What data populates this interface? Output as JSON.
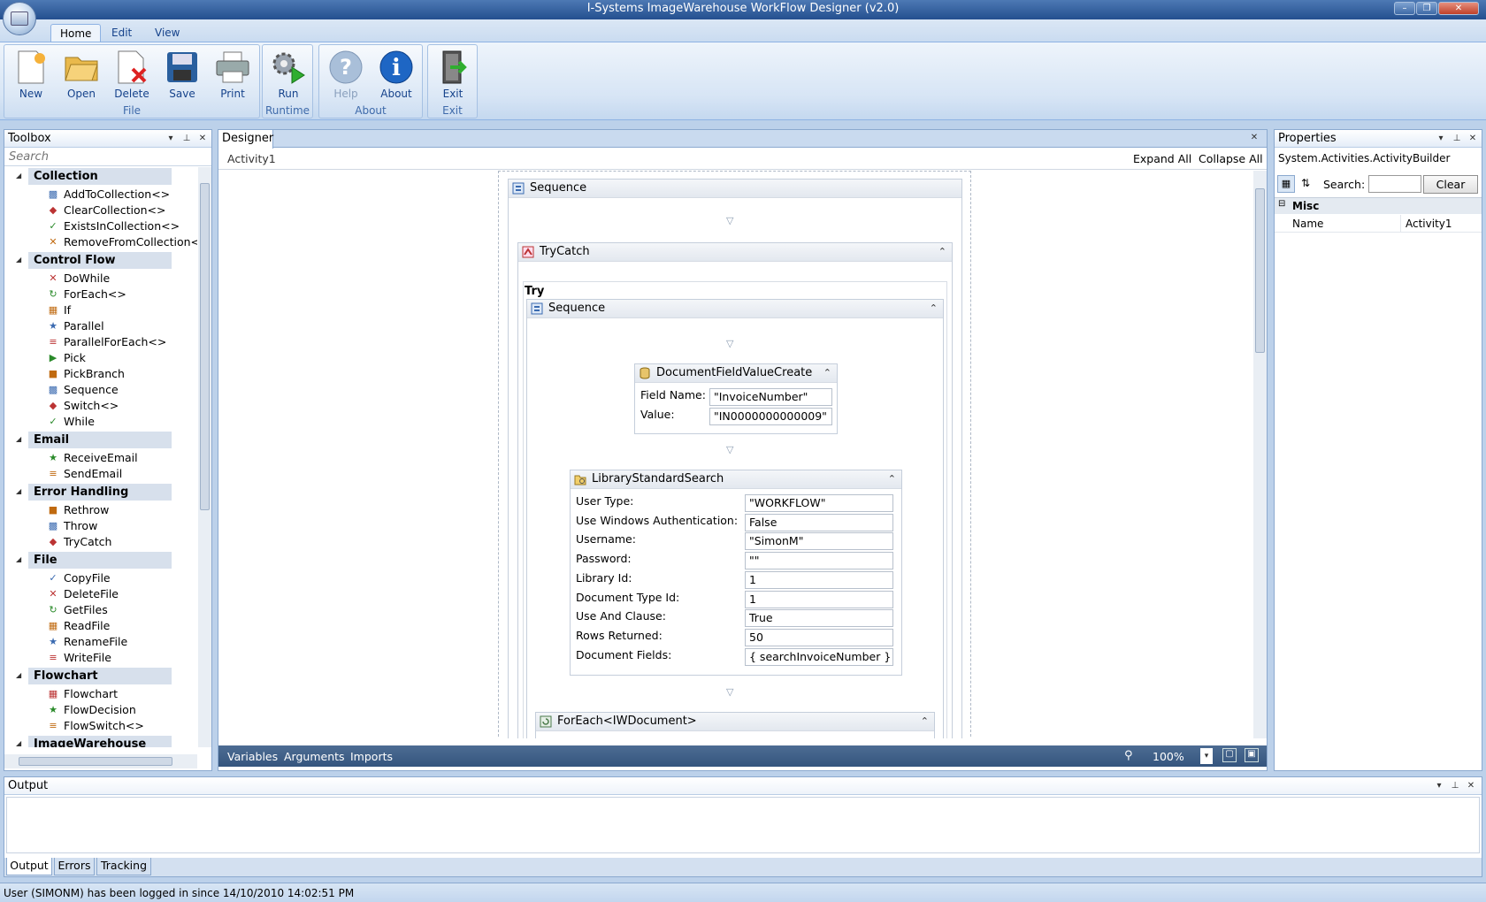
{
  "window": {
    "title": "I-Systems ImageWarehouse WorkFlow Designer (v2.0)"
  },
  "ribbon": {
    "tabs": [
      "Home",
      "Edit",
      "View"
    ],
    "buttons": {
      "new": "New",
      "open": "Open",
      "delete": "Delete",
      "save": "Save",
      "print": "Print",
      "run": "Run",
      "help": "Help",
      "about": "About",
      "exit": "Exit"
    },
    "groups": {
      "file": "File",
      "runtime": "Runtime",
      "about": "About",
      "exit": "Exit"
    }
  },
  "toolbox": {
    "title": "Toolbox",
    "search_placeholder": "Search",
    "categories": [
      {
        "name": "Collection",
        "items": [
          "AddToCollection<>",
          "ClearCollection<>",
          "ExistsInCollection<>",
          "RemoveFromCollection<>"
        ]
      },
      {
        "name": "Control Flow",
        "items": [
          "DoWhile",
          "ForEach<>",
          "If",
          "Parallel",
          "ParallelForEach<>",
          "Pick",
          "PickBranch",
          "Sequence",
          "Switch<>",
          "While"
        ]
      },
      {
        "name": "Email",
        "items": [
          "ReceiveEmail",
          "SendEmail"
        ]
      },
      {
        "name": "Error Handling",
        "items": [
          "Rethrow",
          "Throw",
          "TryCatch"
        ]
      },
      {
        "name": "File",
        "items": [
          "CopyFile",
          "DeleteFile",
          "GetFiles",
          "ReadFile",
          "RenameFile",
          "WriteFile"
        ]
      },
      {
        "name": "Flowchart",
        "items": [
          "Flowchart",
          "FlowDecision",
          "FlowSwitch<>"
        ]
      },
      {
        "name": "ImageWarehouse",
        "items": []
      }
    ]
  },
  "designer": {
    "tab": "Designer",
    "breadcrumb": "Activity1",
    "expand_all": "Expand All",
    "collapse_all": "Collapse All",
    "sequence_outer": "Sequence",
    "trycatch": "TryCatch",
    "try_label": "Try",
    "sequence_inner": "Sequence",
    "dfvc": {
      "title": "DocumentFieldValueCreate",
      "field_name_label": "Field Name:",
      "field_name": "\"InvoiceNumber\"",
      "value_label": "Value:",
      "value": "\"IN0000000000009\""
    },
    "lss": {
      "title": "LibraryStandardSearch",
      "props": [
        {
          "label": "User Type:",
          "value": "\"WORKFLOW\""
        },
        {
          "label": "Use Windows Authentication:",
          "value": "False"
        },
        {
          "label": "Username:",
          "value": "\"SimonM\""
        },
        {
          "label": "Password:",
          "value": "\"\""
        },
        {
          "label": "Library Id:",
          "value": "1"
        },
        {
          "label": "Document Type Id:",
          "value": "1"
        },
        {
          "label": "Use And Clause:",
          "value": "True"
        },
        {
          "label": "Rows Returned:",
          "value": "50"
        },
        {
          "label": "Document Fields:",
          "value": "{ searchInvoiceNumber }"
        }
      ]
    },
    "foreach": "ForEach<IWDocument>",
    "footer": {
      "variables": "Variables",
      "arguments": "Arguments",
      "imports": "Imports",
      "zoom": "100%"
    }
  },
  "properties": {
    "title": "Properties",
    "object": "System.Activities.ActivityBuilder",
    "search_label": "Search:",
    "clear": "Clear",
    "category": "Misc",
    "rows": [
      {
        "name": "Name",
        "value": "Activity1"
      }
    ]
  },
  "output": {
    "title": "Output",
    "tabs": [
      "Output",
      "Errors",
      "Tracking"
    ]
  },
  "status": {
    "text": "User (SIMONM) has been logged in since 14/10/2010 14:02:51 PM"
  },
  "colors": {
    "ribbon_text": "#15428b",
    "titlebar": "#2a5595",
    "panel_border": "#8ba9cf"
  }
}
